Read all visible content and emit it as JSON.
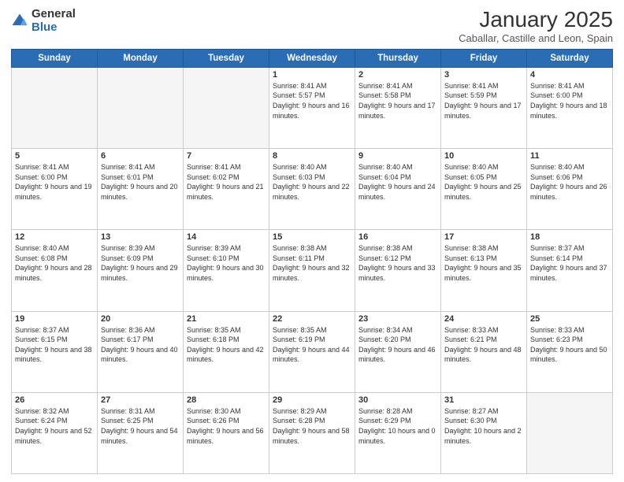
{
  "logo": {
    "general": "General",
    "blue": "Blue"
  },
  "title": {
    "month": "January 2025",
    "location": "Caballar, Castille and Leon, Spain"
  },
  "weekdays": [
    "Sunday",
    "Monday",
    "Tuesday",
    "Wednesday",
    "Thursday",
    "Friday",
    "Saturday"
  ],
  "weeks": [
    [
      {
        "day": "",
        "info": ""
      },
      {
        "day": "",
        "info": ""
      },
      {
        "day": "",
        "info": ""
      },
      {
        "day": "1",
        "info": "Sunrise: 8:41 AM\nSunset: 5:57 PM\nDaylight: 9 hours and 16 minutes."
      },
      {
        "day": "2",
        "info": "Sunrise: 8:41 AM\nSunset: 5:58 PM\nDaylight: 9 hours and 17 minutes."
      },
      {
        "day": "3",
        "info": "Sunrise: 8:41 AM\nSunset: 5:59 PM\nDaylight: 9 hours and 17 minutes."
      },
      {
        "day": "4",
        "info": "Sunrise: 8:41 AM\nSunset: 6:00 PM\nDaylight: 9 hours and 18 minutes."
      }
    ],
    [
      {
        "day": "5",
        "info": "Sunrise: 8:41 AM\nSunset: 6:00 PM\nDaylight: 9 hours and 19 minutes."
      },
      {
        "day": "6",
        "info": "Sunrise: 8:41 AM\nSunset: 6:01 PM\nDaylight: 9 hours and 20 minutes."
      },
      {
        "day": "7",
        "info": "Sunrise: 8:41 AM\nSunset: 6:02 PM\nDaylight: 9 hours and 21 minutes."
      },
      {
        "day": "8",
        "info": "Sunrise: 8:40 AM\nSunset: 6:03 PM\nDaylight: 9 hours and 22 minutes."
      },
      {
        "day": "9",
        "info": "Sunrise: 8:40 AM\nSunset: 6:04 PM\nDaylight: 9 hours and 24 minutes."
      },
      {
        "day": "10",
        "info": "Sunrise: 8:40 AM\nSunset: 6:05 PM\nDaylight: 9 hours and 25 minutes."
      },
      {
        "day": "11",
        "info": "Sunrise: 8:40 AM\nSunset: 6:06 PM\nDaylight: 9 hours and 26 minutes."
      }
    ],
    [
      {
        "day": "12",
        "info": "Sunrise: 8:40 AM\nSunset: 6:08 PM\nDaylight: 9 hours and 28 minutes."
      },
      {
        "day": "13",
        "info": "Sunrise: 8:39 AM\nSunset: 6:09 PM\nDaylight: 9 hours and 29 minutes."
      },
      {
        "day": "14",
        "info": "Sunrise: 8:39 AM\nSunset: 6:10 PM\nDaylight: 9 hours and 30 minutes."
      },
      {
        "day": "15",
        "info": "Sunrise: 8:38 AM\nSunset: 6:11 PM\nDaylight: 9 hours and 32 minutes."
      },
      {
        "day": "16",
        "info": "Sunrise: 8:38 AM\nSunset: 6:12 PM\nDaylight: 9 hours and 33 minutes."
      },
      {
        "day": "17",
        "info": "Sunrise: 8:38 AM\nSunset: 6:13 PM\nDaylight: 9 hours and 35 minutes."
      },
      {
        "day": "18",
        "info": "Sunrise: 8:37 AM\nSunset: 6:14 PM\nDaylight: 9 hours and 37 minutes."
      }
    ],
    [
      {
        "day": "19",
        "info": "Sunrise: 8:37 AM\nSunset: 6:15 PM\nDaylight: 9 hours and 38 minutes."
      },
      {
        "day": "20",
        "info": "Sunrise: 8:36 AM\nSunset: 6:17 PM\nDaylight: 9 hours and 40 minutes."
      },
      {
        "day": "21",
        "info": "Sunrise: 8:35 AM\nSunset: 6:18 PM\nDaylight: 9 hours and 42 minutes."
      },
      {
        "day": "22",
        "info": "Sunrise: 8:35 AM\nSunset: 6:19 PM\nDaylight: 9 hours and 44 minutes."
      },
      {
        "day": "23",
        "info": "Sunrise: 8:34 AM\nSunset: 6:20 PM\nDaylight: 9 hours and 46 minutes."
      },
      {
        "day": "24",
        "info": "Sunrise: 8:33 AM\nSunset: 6:21 PM\nDaylight: 9 hours and 48 minutes."
      },
      {
        "day": "25",
        "info": "Sunrise: 8:33 AM\nSunset: 6:23 PM\nDaylight: 9 hours and 50 minutes."
      }
    ],
    [
      {
        "day": "26",
        "info": "Sunrise: 8:32 AM\nSunset: 6:24 PM\nDaylight: 9 hours and 52 minutes."
      },
      {
        "day": "27",
        "info": "Sunrise: 8:31 AM\nSunset: 6:25 PM\nDaylight: 9 hours and 54 minutes."
      },
      {
        "day": "28",
        "info": "Sunrise: 8:30 AM\nSunset: 6:26 PM\nDaylight: 9 hours and 56 minutes."
      },
      {
        "day": "29",
        "info": "Sunrise: 8:29 AM\nSunset: 6:28 PM\nDaylight: 9 hours and 58 minutes."
      },
      {
        "day": "30",
        "info": "Sunrise: 8:28 AM\nSunset: 6:29 PM\nDaylight: 10 hours and 0 minutes."
      },
      {
        "day": "31",
        "info": "Sunrise: 8:27 AM\nSunset: 6:30 PM\nDaylight: 10 hours and 2 minutes."
      },
      {
        "day": "",
        "info": ""
      }
    ]
  ]
}
